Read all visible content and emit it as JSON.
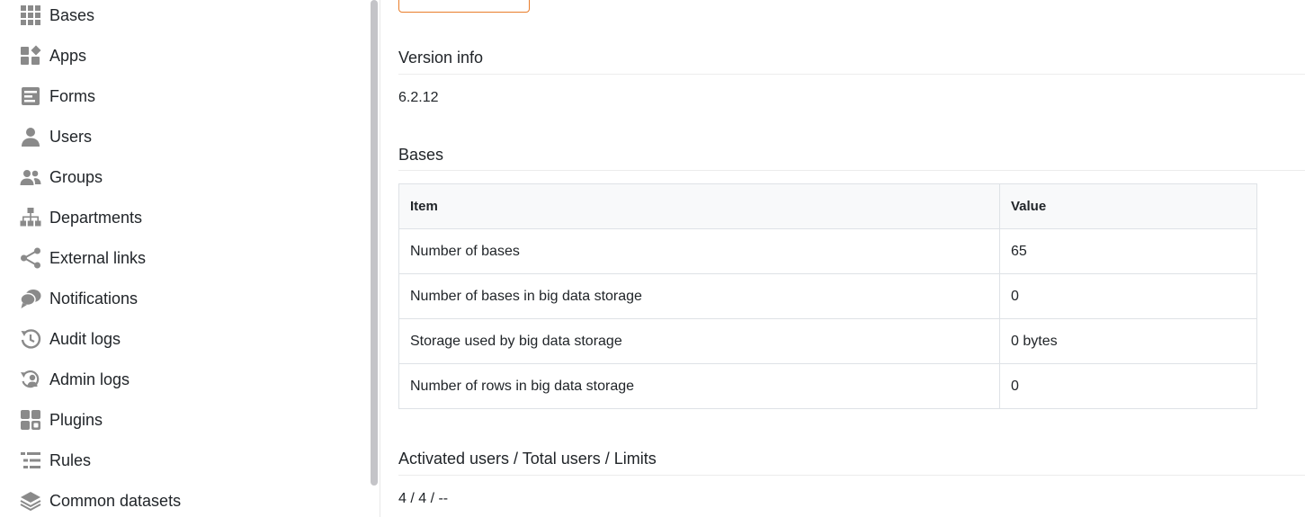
{
  "sidebar": {
    "items": [
      {
        "label": "Bases",
        "icon": "grid-icon"
      },
      {
        "label": "Apps",
        "icon": "apps-icon"
      },
      {
        "label": "Forms",
        "icon": "form-icon"
      },
      {
        "label": "Users",
        "icon": "user-icon"
      },
      {
        "label": "Groups",
        "icon": "group-icon"
      },
      {
        "label": "Departments",
        "icon": "org-chart-icon"
      },
      {
        "label": "External links",
        "icon": "share-icon"
      },
      {
        "label": "Notifications",
        "icon": "chat-bubbles-icon"
      },
      {
        "label": "Audit logs",
        "icon": "history-icon"
      },
      {
        "label": "Admin logs",
        "icon": "admin-history-icon"
      },
      {
        "label": "Plugins",
        "icon": "plugin-icon"
      },
      {
        "label": "Rules",
        "icon": "rules-icon"
      },
      {
        "label": "Common datasets",
        "icon": "layers-icon"
      }
    ]
  },
  "main": {
    "version": {
      "title": "Version info",
      "value": "6.2.12"
    },
    "bases": {
      "title": "Bases",
      "headers": {
        "item": "Item",
        "value": "Value"
      },
      "rows": [
        {
          "item": "Number of bases",
          "value": "65"
        },
        {
          "item": "Number of bases in big data storage",
          "value": "0"
        },
        {
          "item": "Storage used by big data storage",
          "value": "0 bytes"
        },
        {
          "item": "Number of rows in big data storage",
          "value": "0"
        }
      ]
    },
    "users": {
      "title": "Activated users / Total users / Limits",
      "value": "4 / 4 / --"
    }
  },
  "colors": {
    "accent": "#e97d2b",
    "icon": "#8a8a8a"
  }
}
